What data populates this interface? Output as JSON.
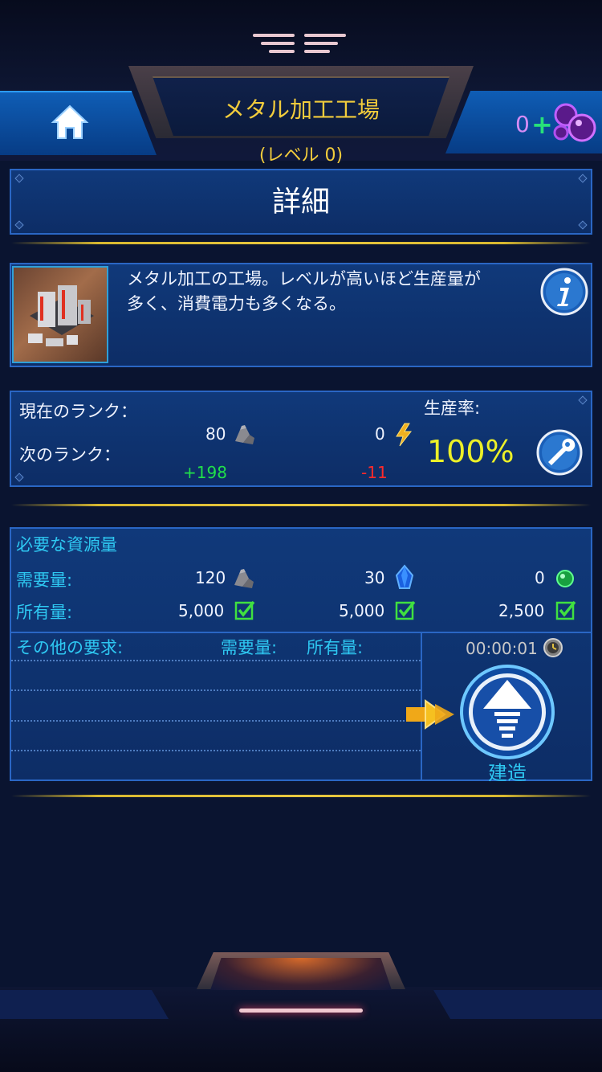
{
  "header": {
    "title": "メタル加工工場",
    "level": "(レベル 0)",
    "gem_count": "0",
    "gem_plus": "+"
  },
  "details": {
    "heading": "詳細",
    "description_line1": "メタル加工の工場。レベルが高いほど生産量が",
    "description_line2": "多く、消費電力も多くなる。"
  },
  "rank": {
    "current_label": "現在のランク：",
    "next_label": "次のランク：",
    "metal_value": "80",
    "power_value": "0",
    "metal_delta": "+198",
    "power_delta": "-11",
    "production_label": "生産率:",
    "production_value": "100%"
  },
  "requirements": {
    "heading": "必要な資源量",
    "required_label": "需要量:",
    "owned_label": "所有量:",
    "resources": [
      {
        "icon": "ore-icon",
        "required": "120",
        "owned": "5,000"
      },
      {
        "icon": "crystal-icon",
        "required": "30",
        "owned": "5,000"
      },
      {
        "icon": "green-gem-icon",
        "required": "0",
        "owned": "2,500"
      }
    ],
    "other_label": "その他の要求:",
    "other_required_label": "需要量:",
    "other_owned_label": "所有量:",
    "timer": "00:00:01",
    "build_label": "建造"
  },
  "colors": {
    "accent_gold": "#f2cc3c",
    "panel_blue": "#10397a",
    "cyan": "#2ec8f2",
    "green": "#20e04a",
    "red": "#ff2a2a",
    "yellow": "#ecf028"
  }
}
